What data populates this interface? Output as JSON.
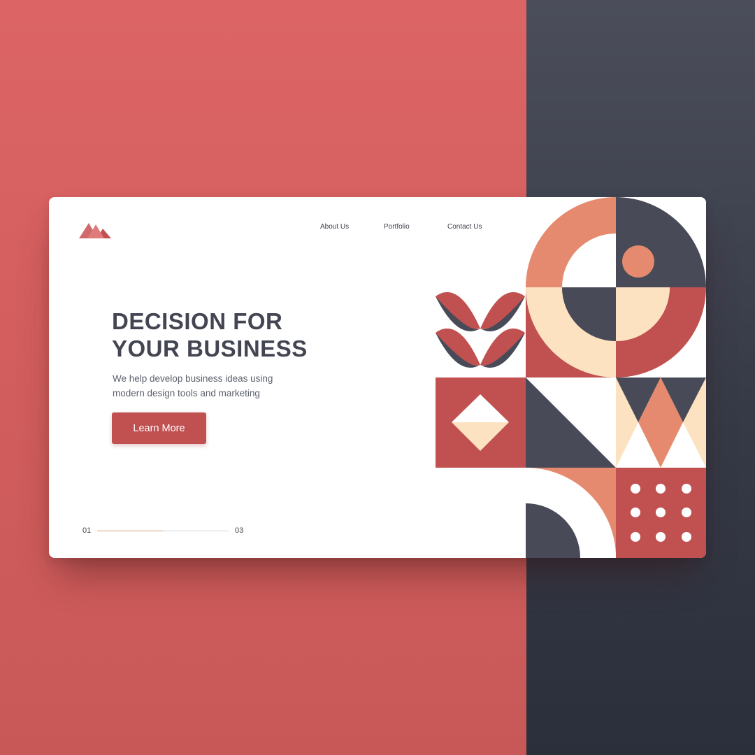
{
  "nav": {
    "links": [
      "About Us",
      "Portfolio",
      "Contact Us"
    ]
  },
  "hero": {
    "headline_line1": "DECISION FOR",
    "headline_line2": "YOUR BUSINESS",
    "subtext_line1": "We help develop business ideas using",
    "subtext_line2": "modern design tools and marketing",
    "cta_label": "Learn More"
  },
  "pager": {
    "current": "01",
    "total": "03",
    "progress": 0.5
  },
  "colors": {
    "coral_background": "#d45e5e",
    "dark_background": "#3a3d4a",
    "brand_red": "#c15151",
    "salmon": "#e58a6e",
    "cream": "#fde2c1",
    "slate": "#484b57",
    "text_dark": "#434652"
  },
  "icons": {
    "logo": "m-logo-icon"
  }
}
